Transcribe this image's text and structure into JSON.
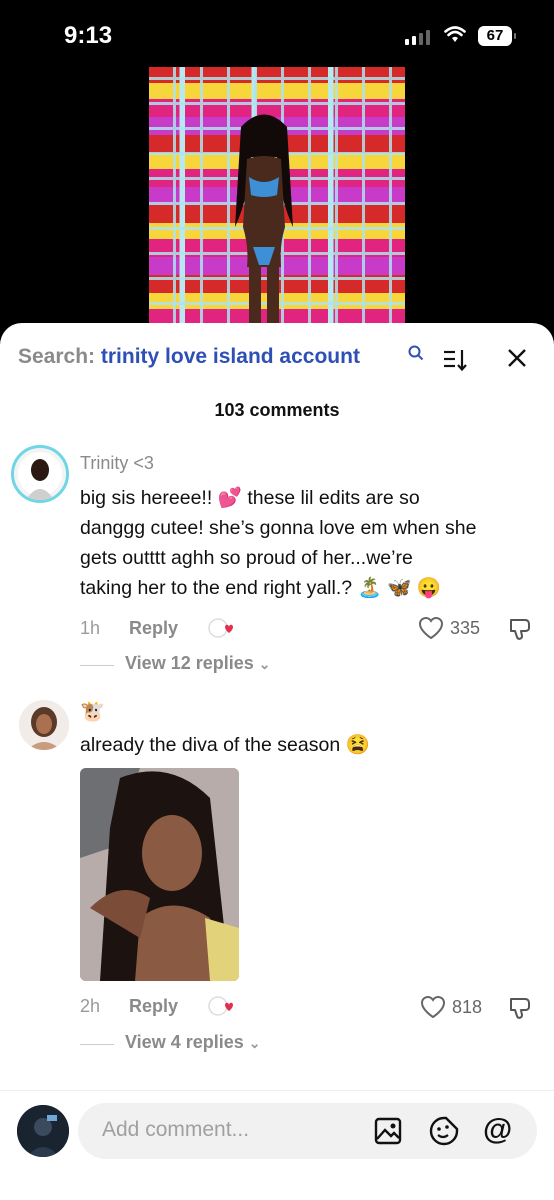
{
  "status": {
    "time": "9:13",
    "battery": "67"
  },
  "search": {
    "prefix": "Search:",
    "query": "trinity love island account"
  },
  "comments_count": "103 comments",
  "comments": [
    {
      "user": "Trinity <3",
      "text_lines": [
        "big sis hereee!! 💕 these lil edits are so",
        "danggg cutee! she’s gonna love em when she",
        "gets outttt aghh so proud of her...we’re",
        "taking her to the end right yall.? 🏝️ 🦋 😛"
      ],
      "time": "1h",
      "reply_label": "Reply",
      "likes": "335",
      "view_replies": "View 12 replies"
    },
    {
      "user": "🐮",
      "text": "already the diva of the season 😫",
      "time": "2h",
      "reply_label": "Reply",
      "likes": "818",
      "view_replies": "View 4 replies"
    }
  ],
  "composer": {
    "placeholder": "Add comment..."
  }
}
